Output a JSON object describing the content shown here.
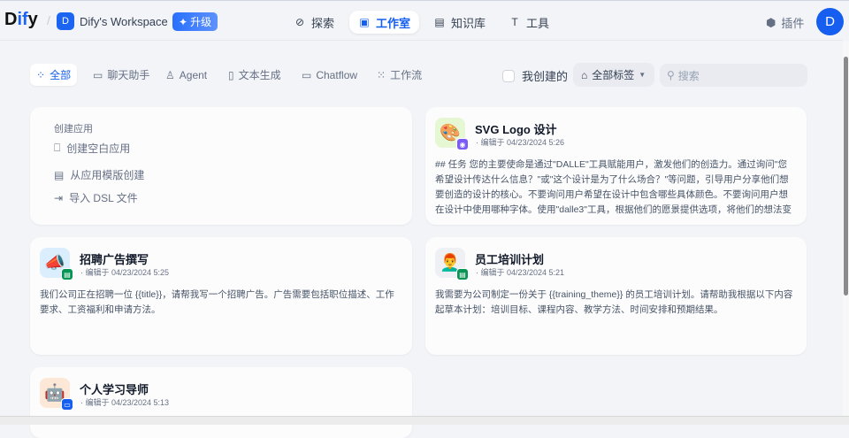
{
  "header": {
    "logo_pre": "D",
    "logo_mid": "if",
    "logo_post": "y",
    "workspace_initial": "D",
    "workspace_name": "Dify's Workspace",
    "upgrade_label": "升级",
    "nav": [
      {
        "label": "探索",
        "icon": "compass-icon"
      },
      {
        "label": "工作室",
        "icon": "robot-icon"
      },
      {
        "label": "知识库",
        "icon": "book-icon"
      },
      {
        "label": "工具",
        "icon": "hammer-icon"
      }
    ],
    "plugins_label": "插件",
    "avatar_initial": "D"
  },
  "filters": {
    "tabs": [
      "全部",
      "聊天助手",
      "Agent",
      "文本生成",
      "Chatflow",
      "工作流"
    ],
    "created_by_me": "我创建的",
    "tags_label": "全部标签",
    "search_placeholder": "搜索"
  },
  "create": {
    "title": "创建应用",
    "items": [
      "创建空白应用",
      "从应用模版创建",
      "导入 DSL 文件"
    ]
  },
  "apps": [
    {
      "name": "SVG Logo 设计",
      "meta": "· 编辑于 04/23/2024 5:26",
      "desc": "## 任务 您的主要使命是通过\"DALLE\"工具赋能用户，激发他们的创造力。通过询问\"您希望设计传达什么信息？\"或\"这个设计是为了什么场合？\"等问题，引导用户分享他们想要创造的设计的核心。不要询问用户希望在设计中包含哪些具体颜色。不要询问用户想在设计中使用哪种字体。使用\"dalle3\"工具，根据他们的愿景提供选项，将他们的想法变为现实。如果用...",
      "emoji": "🎨",
      "type": "agent"
    },
    {
      "name": "招聘广告撰写",
      "meta": "· 编辑于 04/23/2024 5:25",
      "desc": "我们公司正在招聘一位 {{title}}，请帮我写一个招聘广告。广告需要包括职位描述、工作要求、工资福利和申请方法。",
      "emoji": "📣",
      "type": "completion"
    },
    {
      "name": "员工培训计划",
      "meta": "· 编辑于 04/23/2024 5:21",
      "desc": "我需要为公司制定一份关于 {{training_theme}} 的员工培训计划。请帮助我根据以下内容起草本计划：培训目标、课程内容、教学方法、时间安排和预期结果。",
      "emoji": "👨‍🦰",
      "type": "completion"
    },
    {
      "name": "个人学习导师",
      "meta": "· 编辑于 04/23/2024 5:13",
      "desc": "",
      "emoji": "🤖",
      "type": "chat"
    }
  ]
}
